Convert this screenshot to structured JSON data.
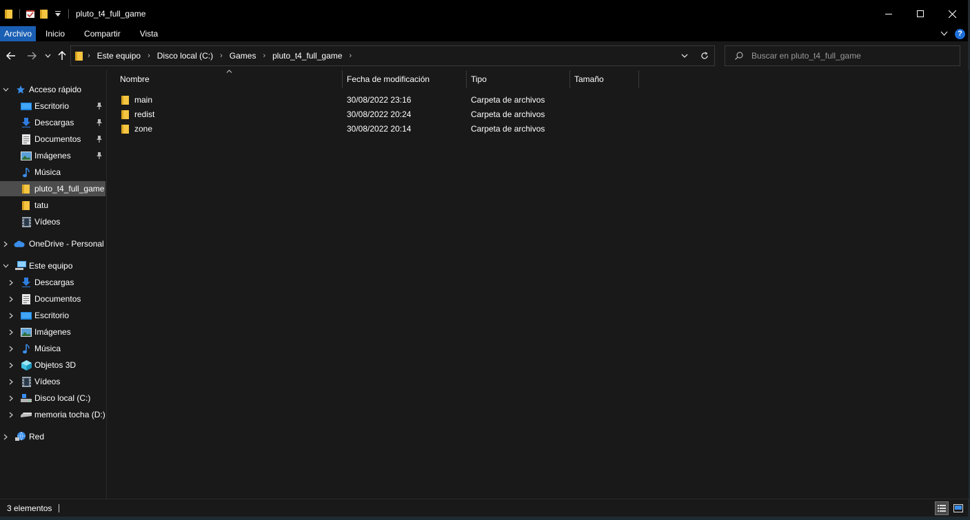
{
  "window": {
    "title": "pluto_t4_full_game"
  },
  "ribbon": {
    "tabs": [
      {
        "label": "Archivo",
        "active": true
      },
      {
        "label": "Inicio"
      },
      {
        "label": "Compartir"
      },
      {
        "label": "Vista"
      }
    ],
    "help_label": "?"
  },
  "address": {
    "breadcrumbs": [
      "Este equipo",
      "Disco local (C:)",
      "Games",
      "pluto_t4_full_game"
    ]
  },
  "search": {
    "placeholder": "Buscar en pluto_t4_full_game"
  },
  "sidebar": {
    "quick_access": {
      "label": "Acceso rápido",
      "items": [
        {
          "label": "Escritorio",
          "icon": "desktop-icon",
          "pinned": true
        },
        {
          "label": "Descargas",
          "icon": "download-icon",
          "pinned": true
        },
        {
          "label": "Documentos",
          "icon": "document-icon",
          "pinned": true
        },
        {
          "label": "Imágenes",
          "icon": "pictures-icon",
          "pinned": true
        },
        {
          "label": "Música",
          "icon": "music-icon"
        },
        {
          "label": "pluto_t4_full_game",
          "icon": "folder-icon",
          "selected": true
        },
        {
          "label": "tatu",
          "icon": "folder-icon"
        },
        {
          "label": "Vídeos",
          "icon": "videos-icon"
        }
      ]
    },
    "onedrive": {
      "label": "OneDrive - Personal"
    },
    "this_pc": {
      "label": "Este equipo",
      "items": [
        {
          "label": "Descargas",
          "icon": "download-icon"
        },
        {
          "label": "Documentos",
          "icon": "document-icon"
        },
        {
          "label": "Escritorio",
          "icon": "desktop-icon"
        },
        {
          "label": "Imágenes",
          "icon": "pictures-icon"
        },
        {
          "label": "Música",
          "icon": "music-icon"
        },
        {
          "label": "Objetos 3D",
          "icon": "3d-objects-icon"
        },
        {
          "label": "Vídeos",
          "icon": "videos-icon"
        },
        {
          "label": "Disco local (C:)",
          "icon": "drive-icon"
        },
        {
          "label": "memoria tocha (D:)",
          "icon": "usb-drive-icon"
        }
      ]
    },
    "network": {
      "label": "Red"
    }
  },
  "columns": {
    "name": "Nombre",
    "modified": "Fecha de modificación",
    "type": "Tipo",
    "size": "Tamaño"
  },
  "files": [
    {
      "name": "main",
      "modified": "30/08/2022 23:16",
      "type": "Carpeta de archivos"
    },
    {
      "name": "redist",
      "modified": "30/08/2022 20:24",
      "type": "Carpeta de archivos"
    },
    {
      "name": "zone",
      "modified": "30/08/2022 20:14",
      "type": "Carpeta de archivos"
    }
  ],
  "status": {
    "count_text": "3 elementos"
  },
  "colors": {
    "accent": "#1a5fb4",
    "folder": "#f5c542",
    "background": "#191919"
  }
}
